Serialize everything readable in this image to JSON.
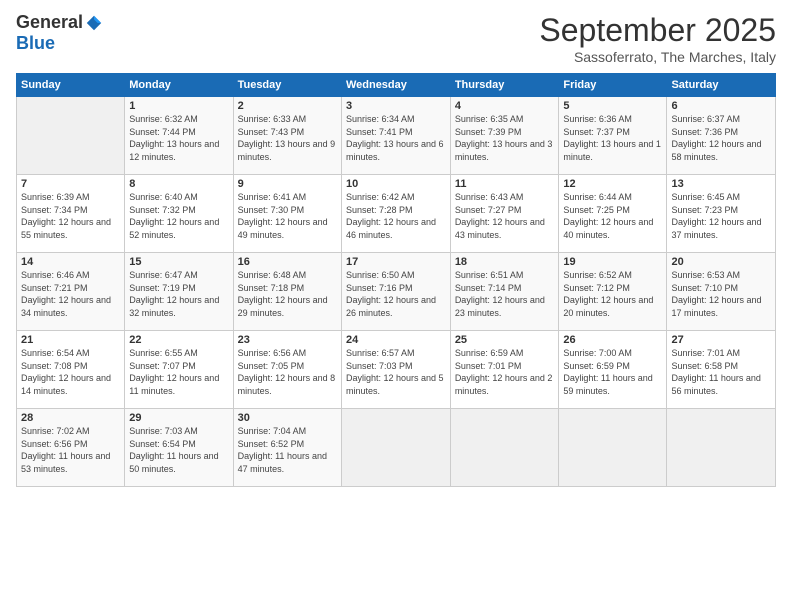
{
  "logo": {
    "general": "General",
    "blue": "Blue"
  },
  "title": "September 2025",
  "location": "Sassoferrato, The Marches, Italy",
  "headers": [
    "Sunday",
    "Monday",
    "Tuesday",
    "Wednesday",
    "Thursday",
    "Friday",
    "Saturday"
  ],
  "weeks": [
    [
      {
        "day": "",
        "sunrise": "",
        "sunset": "",
        "daylight": ""
      },
      {
        "day": "1",
        "sunrise": "Sunrise: 6:32 AM",
        "sunset": "Sunset: 7:44 PM",
        "daylight": "Daylight: 13 hours and 12 minutes."
      },
      {
        "day": "2",
        "sunrise": "Sunrise: 6:33 AM",
        "sunset": "Sunset: 7:43 PM",
        "daylight": "Daylight: 13 hours and 9 minutes."
      },
      {
        "day": "3",
        "sunrise": "Sunrise: 6:34 AM",
        "sunset": "Sunset: 7:41 PM",
        "daylight": "Daylight: 13 hours and 6 minutes."
      },
      {
        "day": "4",
        "sunrise": "Sunrise: 6:35 AM",
        "sunset": "Sunset: 7:39 PM",
        "daylight": "Daylight: 13 hours and 3 minutes."
      },
      {
        "day": "5",
        "sunrise": "Sunrise: 6:36 AM",
        "sunset": "Sunset: 7:37 PM",
        "daylight": "Daylight: 13 hours and 1 minute."
      },
      {
        "day": "6",
        "sunrise": "Sunrise: 6:37 AM",
        "sunset": "Sunset: 7:36 PM",
        "daylight": "Daylight: 12 hours and 58 minutes."
      }
    ],
    [
      {
        "day": "7",
        "sunrise": "Sunrise: 6:39 AM",
        "sunset": "Sunset: 7:34 PM",
        "daylight": "Daylight: 12 hours and 55 minutes."
      },
      {
        "day": "8",
        "sunrise": "Sunrise: 6:40 AM",
        "sunset": "Sunset: 7:32 PM",
        "daylight": "Daylight: 12 hours and 52 minutes."
      },
      {
        "day": "9",
        "sunrise": "Sunrise: 6:41 AM",
        "sunset": "Sunset: 7:30 PM",
        "daylight": "Daylight: 12 hours and 49 minutes."
      },
      {
        "day": "10",
        "sunrise": "Sunrise: 6:42 AM",
        "sunset": "Sunset: 7:28 PM",
        "daylight": "Daylight: 12 hours and 46 minutes."
      },
      {
        "day": "11",
        "sunrise": "Sunrise: 6:43 AM",
        "sunset": "Sunset: 7:27 PM",
        "daylight": "Daylight: 12 hours and 43 minutes."
      },
      {
        "day": "12",
        "sunrise": "Sunrise: 6:44 AM",
        "sunset": "Sunset: 7:25 PM",
        "daylight": "Daylight: 12 hours and 40 minutes."
      },
      {
        "day": "13",
        "sunrise": "Sunrise: 6:45 AM",
        "sunset": "Sunset: 7:23 PM",
        "daylight": "Daylight: 12 hours and 37 minutes."
      }
    ],
    [
      {
        "day": "14",
        "sunrise": "Sunrise: 6:46 AM",
        "sunset": "Sunset: 7:21 PM",
        "daylight": "Daylight: 12 hours and 34 minutes."
      },
      {
        "day": "15",
        "sunrise": "Sunrise: 6:47 AM",
        "sunset": "Sunset: 7:19 PM",
        "daylight": "Daylight: 12 hours and 32 minutes."
      },
      {
        "day": "16",
        "sunrise": "Sunrise: 6:48 AM",
        "sunset": "Sunset: 7:18 PM",
        "daylight": "Daylight: 12 hours and 29 minutes."
      },
      {
        "day": "17",
        "sunrise": "Sunrise: 6:50 AM",
        "sunset": "Sunset: 7:16 PM",
        "daylight": "Daylight: 12 hours and 26 minutes."
      },
      {
        "day": "18",
        "sunrise": "Sunrise: 6:51 AM",
        "sunset": "Sunset: 7:14 PM",
        "daylight": "Daylight: 12 hours and 23 minutes."
      },
      {
        "day": "19",
        "sunrise": "Sunrise: 6:52 AM",
        "sunset": "Sunset: 7:12 PM",
        "daylight": "Daylight: 12 hours and 20 minutes."
      },
      {
        "day": "20",
        "sunrise": "Sunrise: 6:53 AM",
        "sunset": "Sunset: 7:10 PM",
        "daylight": "Daylight: 12 hours and 17 minutes."
      }
    ],
    [
      {
        "day": "21",
        "sunrise": "Sunrise: 6:54 AM",
        "sunset": "Sunset: 7:08 PM",
        "daylight": "Daylight: 12 hours and 14 minutes."
      },
      {
        "day": "22",
        "sunrise": "Sunrise: 6:55 AM",
        "sunset": "Sunset: 7:07 PM",
        "daylight": "Daylight: 12 hours and 11 minutes."
      },
      {
        "day": "23",
        "sunrise": "Sunrise: 6:56 AM",
        "sunset": "Sunset: 7:05 PM",
        "daylight": "Daylight: 12 hours and 8 minutes."
      },
      {
        "day": "24",
        "sunrise": "Sunrise: 6:57 AM",
        "sunset": "Sunset: 7:03 PM",
        "daylight": "Daylight: 12 hours and 5 minutes."
      },
      {
        "day": "25",
        "sunrise": "Sunrise: 6:59 AM",
        "sunset": "Sunset: 7:01 PM",
        "daylight": "Daylight: 12 hours and 2 minutes."
      },
      {
        "day": "26",
        "sunrise": "Sunrise: 7:00 AM",
        "sunset": "Sunset: 6:59 PM",
        "daylight": "Daylight: 11 hours and 59 minutes."
      },
      {
        "day": "27",
        "sunrise": "Sunrise: 7:01 AM",
        "sunset": "Sunset: 6:58 PM",
        "daylight": "Daylight: 11 hours and 56 minutes."
      }
    ],
    [
      {
        "day": "28",
        "sunrise": "Sunrise: 7:02 AM",
        "sunset": "Sunset: 6:56 PM",
        "daylight": "Daylight: 11 hours and 53 minutes."
      },
      {
        "day": "29",
        "sunrise": "Sunrise: 7:03 AM",
        "sunset": "Sunset: 6:54 PM",
        "daylight": "Daylight: 11 hours and 50 minutes."
      },
      {
        "day": "30",
        "sunrise": "Sunrise: 7:04 AM",
        "sunset": "Sunset: 6:52 PM",
        "daylight": "Daylight: 11 hours and 47 minutes."
      },
      {
        "day": "",
        "sunrise": "",
        "sunset": "",
        "daylight": ""
      },
      {
        "day": "",
        "sunrise": "",
        "sunset": "",
        "daylight": ""
      },
      {
        "day": "",
        "sunrise": "",
        "sunset": "",
        "daylight": ""
      },
      {
        "day": "",
        "sunrise": "",
        "sunset": "",
        "daylight": ""
      }
    ]
  ]
}
